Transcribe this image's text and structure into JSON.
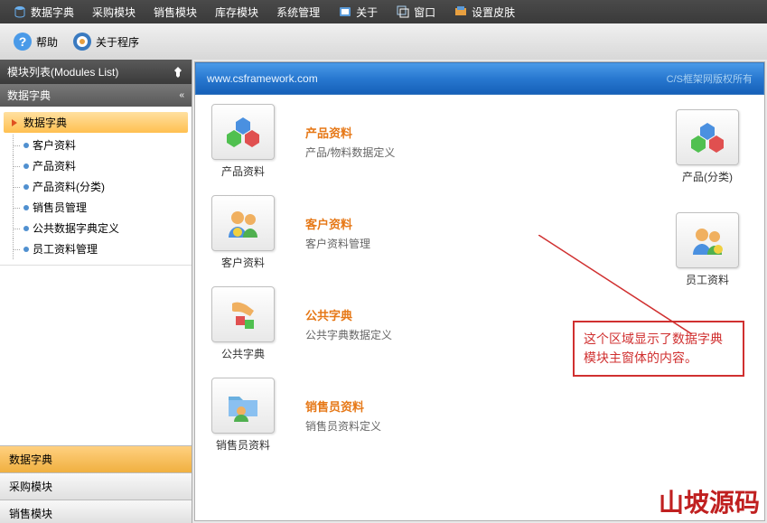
{
  "menubar": [
    {
      "label": "数据字典"
    },
    {
      "label": "采购模块"
    },
    {
      "label": "销售模块"
    },
    {
      "label": "库存模块"
    },
    {
      "label": "系统管理"
    },
    {
      "label": "关于"
    },
    {
      "label": "窗口"
    },
    {
      "label": "设置皮肤"
    }
  ],
  "toolbar": {
    "help_label": "帮助",
    "about_label": "关于程序"
  },
  "sidebar": {
    "header": "模块列表(Modules List)",
    "section_title": "数据字典",
    "tree_root": "数据字典",
    "tree_items": [
      "客户资料",
      "产品资料",
      "产品资料(分类)",
      "销售员管理",
      "公共数据字典定义",
      "员工资料管理"
    ],
    "bottom": [
      "数据字典",
      "采购模块",
      "销售模块"
    ]
  },
  "content": {
    "header_url": "www.csframework.com",
    "header_right": "C/S框架网版权所有",
    "rows": [
      {
        "tile_label": "产品资料",
        "title": "产品资料",
        "sub": "产品/物料数据定义"
      },
      {
        "tile_label": "客户资料",
        "title": "客户资料",
        "sub": "客户资料管理"
      },
      {
        "tile_label": "公共字典",
        "title": "公共字典",
        "sub": "公共字典数据定义"
      },
      {
        "tile_label": "销售员资料",
        "title": "销售员资料",
        "sub": "销售员资料定义"
      }
    ],
    "right_tiles": [
      "产品(分类)",
      "员工资料"
    ]
  },
  "annotation": "这个区域显示了数据字典模块主窗体的内容。",
  "watermark": "山坡源码"
}
